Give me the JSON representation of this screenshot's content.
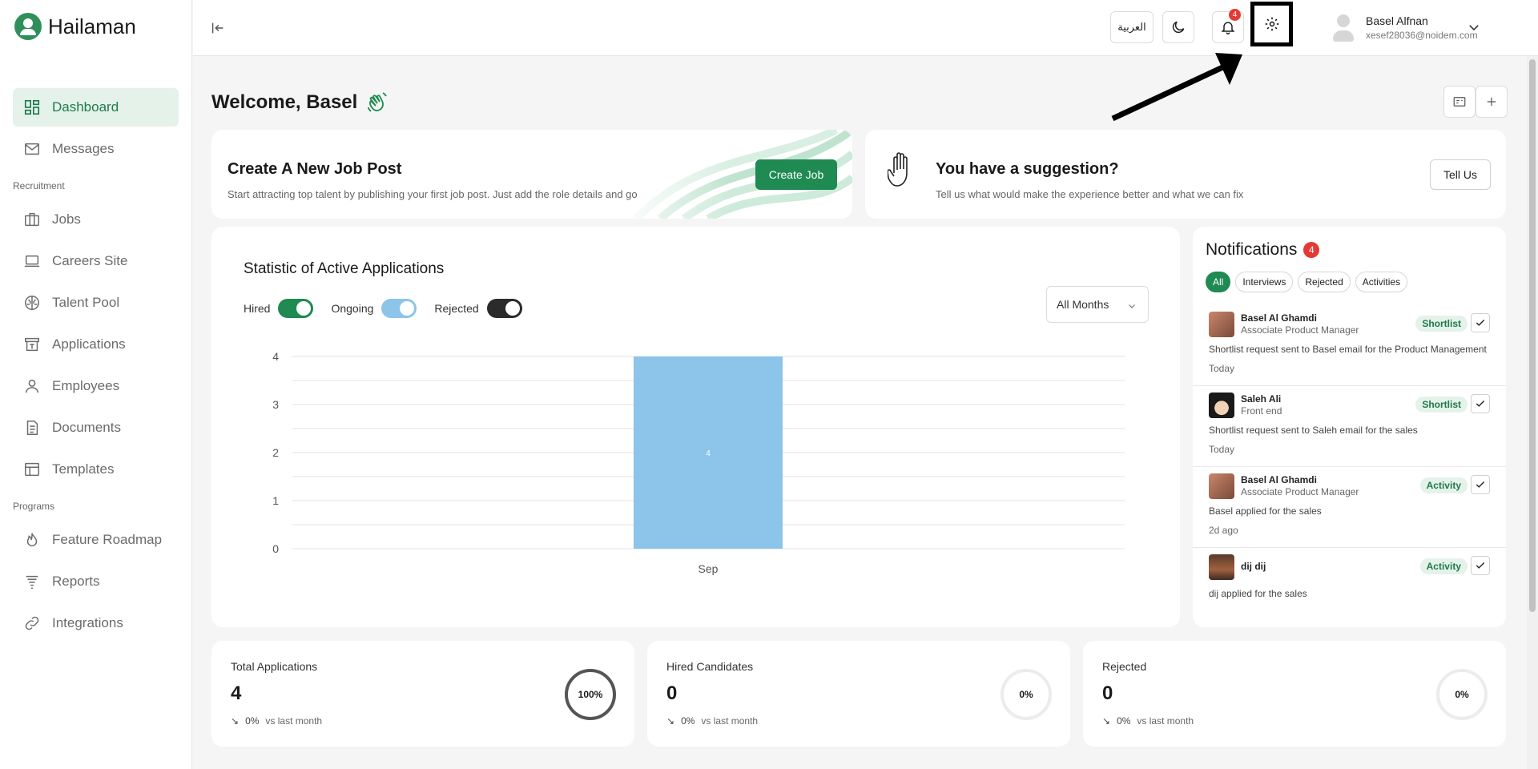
{
  "brand": {
    "name": "Hailaman"
  },
  "sidebar": {
    "primary": [
      {
        "label": "Dashboard",
        "icon": "dashboard-icon",
        "active": true
      },
      {
        "label": "Messages",
        "icon": "mail-icon"
      }
    ],
    "recruitment_title": "Recruitment",
    "recruitment": [
      {
        "label": "Jobs",
        "icon": "briefcase-icon"
      },
      {
        "label": "Careers Site",
        "icon": "laptop-icon"
      },
      {
        "label": "Talent Pool",
        "icon": "brain-icon"
      },
      {
        "label": "Applications",
        "icon": "inbox-icon"
      },
      {
        "label": "Employees",
        "icon": "person-icon"
      },
      {
        "label": "Documents",
        "icon": "document-icon"
      },
      {
        "label": "Templates",
        "icon": "template-icon"
      }
    ],
    "programs_title": "Programs",
    "programs": [
      {
        "label": "Feature Roadmap",
        "icon": "flame-icon"
      },
      {
        "label": "Reports",
        "icon": "reports-icon"
      },
      {
        "label": "Integrations",
        "icon": "link-icon"
      }
    ]
  },
  "topbar": {
    "language_label": "العربية",
    "notification_count": "4",
    "user_name": "Basel Alfnan",
    "user_email": "xesef28036@noidem.com"
  },
  "welcome": {
    "text": "Welcome, Basel"
  },
  "job_card": {
    "title": "Create A New Job Post",
    "subtitle": "Start attracting top talent by publishing your first job post. Just add the role details and go",
    "button": "Create Job"
  },
  "suggestion_card": {
    "title": "You have a suggestion?",
    "subtitle": "Tell us what would make the experience better and what we can fix",
    "button": "Tell Us"
  },
  "chart_section": {
    "title": "Statistic of Active Applications",
    "toggles": [
      {
        "label": "Hired",
        "color": "#1f8a52"
      },
      {
        "label": "Ongoing",
        "color": "#8cc4ea"
      },
      {
        "label": "Rejected",
        "color": "#2b2b2b"
      }
    ],
    "month_filter": "All Months"
  },
  "chart_data": {
    "type": "bar",
    "categories": [
      "Sep"
    ],
    "values": [
      4
    ],
    "data_labels": [
      "4"
    ],
    "ylim": [
      0,
      4
    ],
    "yticks": [
      0,
      1,
      2,
      3,
      4
    ],
    "bar_color": "#8cc4ea",
    "grid": true
  },
  "notifications": {
    "title": "Notifications",
    "count": "4",
    "filters": [
      {
        "label": "All",
        "active": true
      },
      {
        "label": "Interviews"
      },
      {
        "label": "Rejected"
      },
      {
        "label": "Activities"
      }
    ],
    "items": [
      {
        "name": "Basel Al Ghamdi",
        "role": "Associate Product Manager",
        "tag": "Shortlist",
        "text": "Shortlist request sent to Basel email for the Product Management",
        "time": "Today"
      },
      {
        "name": "Saleh Ali",
        "role": "Front end",
        "tag": "Shortlist",
        "text": "Shortlist request sent to Saleh email for the sales",
        "time": "Today"
      },
      {
        "name": "Basel Al Ghamdi",
        "role": "Associate Product Manager",
        "tag": "Activity",
        "text": "Basel applied for the sales",
        "time": "2d ago"
      },
      {
        "name": "dij dij",
        "role": "",
        "tag": "Activity",
        "text": "dij applied for the sales",
        "time": ""
      }
    ]
  },
  "stats": [
    {
      "label": "Total Applications",
      "value": "4",
      "trend": "0%",
      "trend_note": "vs last month",
      "ring": "100%",
      "ring_fraction": 1
    },
    {
      "label": "Hired Candidates",
      "value": "0",
      "trend": "0%",
      "trend_note": "vs last month",
      "ring": "0%",
      "ring_fraction": 0
    },
    {
      "label": "Rejected",
      "value": "0",
      "trend": "0%",
      "trend_note": "vs last month",
      "ring": "0%",
      "ring_fraction": 0
    }
  ]
}
